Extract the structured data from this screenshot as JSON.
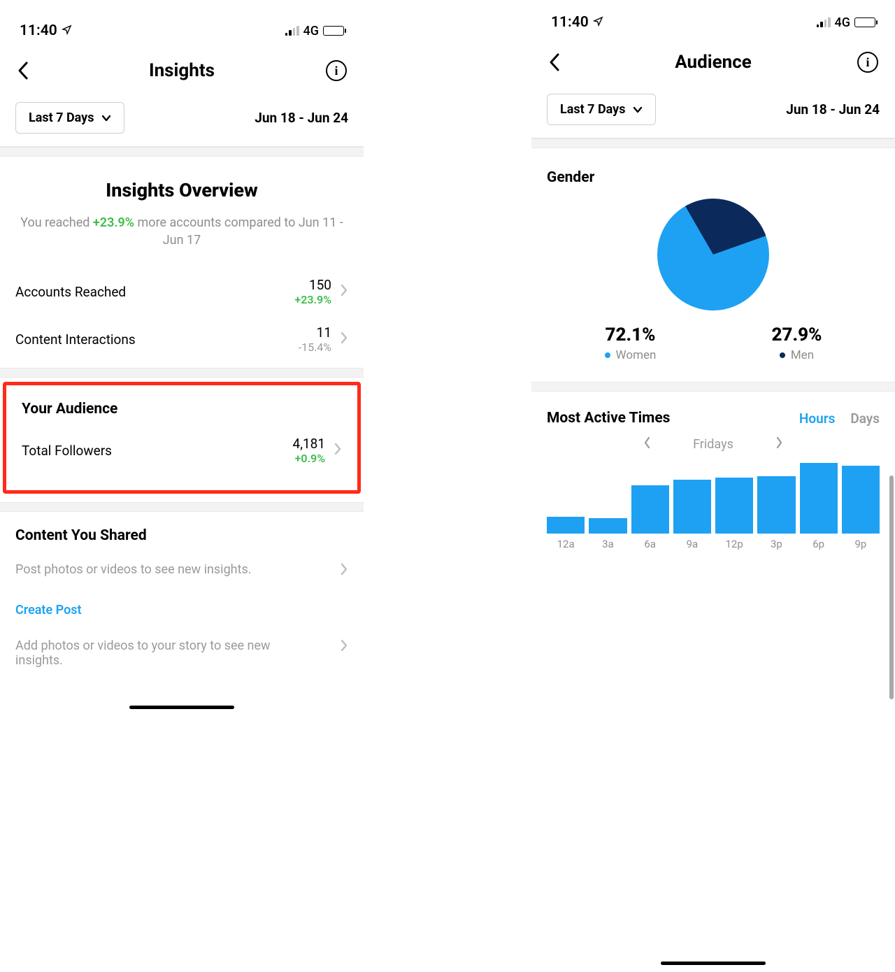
{
  "status": {
    "time": "11:40",
    "network": "4G"
  },
  "left": {
    "title": "Insights",
    "filter_label": "Last 7 Days",
    "date_range": "Jun 18 - Jun 24",
    "overview": {
      "heading": "Insights Overview",
      "pre_text": "You reached ",
      "pct": "+23.9%",
      "post_text": " more accounts compared to Jun 11 - Jun 17"
    },
    "metrics": {
      "accounts_reached": {
        "label": "Accounts Reached",
        "value": "150",
        "delta": "+23.9%"
      },
      "content_interactions": {
        "label": "Content Interactions",
        "value": "11",
        "delta": "-15.4%"
      }
    },
    "audience": {
      "heading": "Your Audience",
      "followers_label": "Total Followers",
      "followers_value": "4,181",
      "followers_delta": "+0.9%"
    },
    "content_shared": {
      "heading": "Content You Shared",
      "post_hint": "Post photos or videos to see new insights.",
      "create_post": "Create Post",
      "story_hint": "Add photos or videos to your story to see new insights."
    }
  },
  "right": {
    "title": "Audience",
    "filter_label": "Last 7 Days",
    "date_range": "Jun 18 - Jun 24",
    "gender": {
      "heading": "Gender",
      "women_pct": "72.1%",
      "women_label": "Women",
      "men_pct": "27.9%",
      "men_label": "Men"
    },
    "active": {
      "heading": "Most Active Times",
      "hours": "Hours",
      "days": "Days",
      "day": "Fridays"
    }
  },
  "chart_data": [
    {
      "type": "pie",
      "title": "Gender",
      "series": [
        {
          "name": "Women",
          "value": 72.1,
          "color": "#1ea1f2"
        },
        {
          "name": "Men",
          "value": 27.9,
          "color": "#0b2a5b"
        }
      ]
    },
    {
      "type": "bar",
      "title": "Most Active Times",
      "subtitle": "Fridays",
      "categories": [
        "12a",
        "3a",
        "6a",
        "9a",
        "12p",
        "3p",
        "6p",
        "9p"
      ],
      "values": [
        22,
        20,
        63,
        70,
        73,
        75,
        92,
        88
      ],
      "ylim": [
        0,
        100
      ],
      "xlabel": "",
      "ylabel": ""
    }
  ],
  "colors": {
    "blue": "#1ea1f2",
    "navy": "#0b2a5b",
    "green": "#3bbd4a",
    "gray": "#8e8e8e",
    "highlight": "#ff2a1a"
  }
}
